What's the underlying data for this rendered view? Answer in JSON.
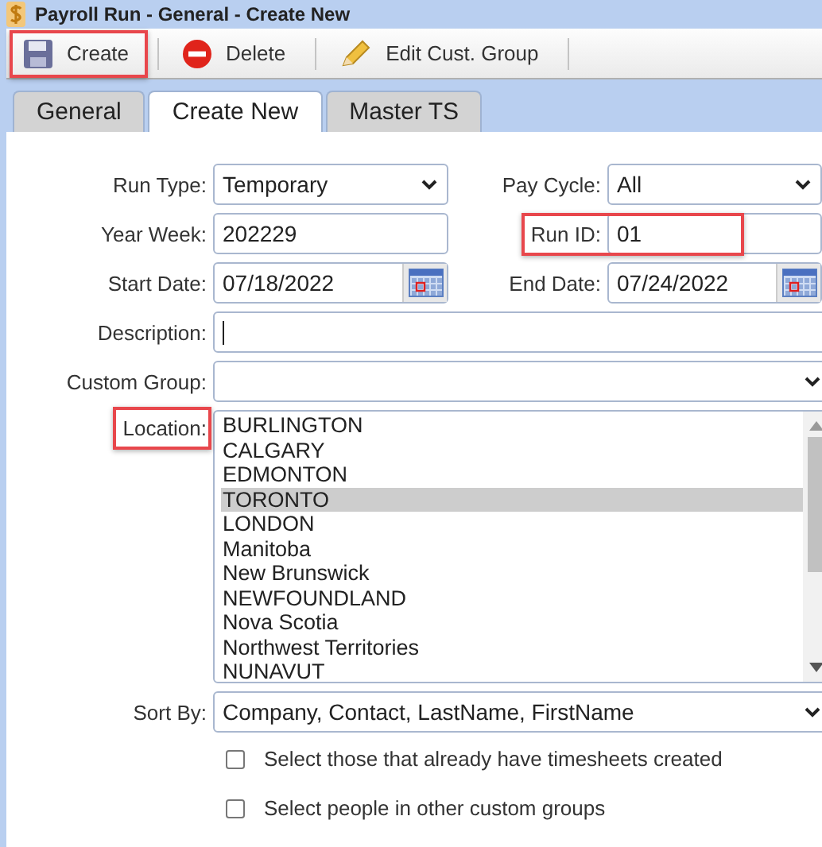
{
  "window": {
    "title": "Payroll Run - General - Create New"
  },
  "toolbar": [
    {
      "kind": "save",
      "label": "Create",
      "highlighted": true
    },
    {
      "kind": "delete",
      "label": "Delete",
      "highlighted": false
    },
    {
      "kind": "edit",
      "label": "Edit Cust. Group",
      "highlighted": false
    }
  ],
  "tabs": [
    {
      "label": "General",
      "selected": false
    },
    {
      "label": "Create New",
      "selected": true
    },
    {
      "label": "Master TS",
      "selected": false
    }
  ],
  "form": {
    "run_type": {
      "label": "Run Type:",
      "value": "Temporary"
    },
    "pay_cycle": {
      "label": "Pay Cycle:",
      "value": "All"
    },
    "year_week": {
      "label": "Year Week:",
      "value": "202229"
    },
    "run_id": {
      "label": "Run ID:",
      "value": "01",
      "highlighted": true
    },
    "start_date": {
      "label": "Start Date:",
      "value": "07/18/2022"
    },
    "end_date": {
      "label": "End Date:",
      "value": "07/24/2022"
    },
    "description": {
      "label": "Description:",
      "focused": true
    },
    "custom_group": {
      "label": "Custom Group:"
    },
    "location": {
      "label": "Location:",
      "highlighted": true,
      "items": [
        {
          "label": "BURLINGTON",
          "selected": false
        },
        {
          "label": "CALGARY",
          "selected": false
        },
        {
          "label": "EDMONTON",
          "selected": false
        },
        {
          "label": "TORONTO",
          "selected": true
        },
        {
          "label": "LONDON",
          "selected": false
        },
        {
          "label": "Manitoba",
          "selected": false
        },
        {
          "label": "New Brunswick",
          "selected": false
        },
        {
          "label": "NEWFOUNDLAND",
          "selected": false
        },
        {
          "label": "Nova Scotia",
          "selected": false
        },
        {
          "label": "Northwest Territories",
          "selected": false
        },
        {
          "label": "NUNAVUT",
          "selected": false
        }
      ]
    },
    "sort_by": {
      "label": "Sort By:",
      "value": "Company, Contact, LastName, FirstName"
    },
    "options": [
      {
        "label": "Select those that already have timesheets created",
        "checked": false
      },
      {
        "label": "Select people in other custom groups",
        "checked": false
      }
    ]
  }
}
